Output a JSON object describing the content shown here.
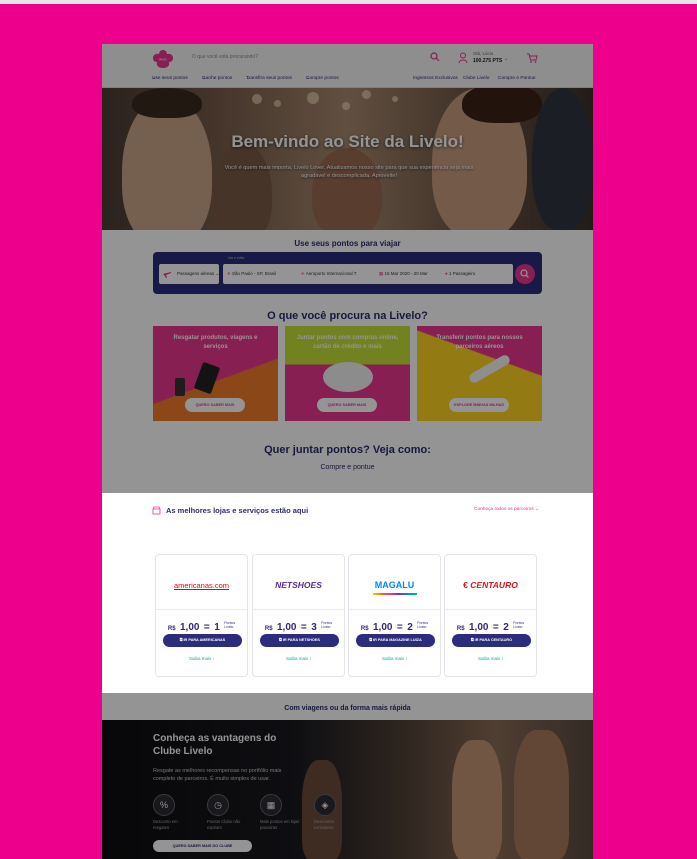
{
  "header": {
    "search_placeholder": "O que você está procurando?",
    "greeting": "Olá, Lúcio",
    "points": "100.275 PTS",
    "nav_left": [
      "Use seus pontos",
      "Ganhe pontos",
      "Transfira seus pontos",
      "Compre pontos"
    ],
    "nav_right": [
      "Ingressos Exclusivos",
      "Clube Livelo",
      "Compre e Pontue"
    ]
  },
  "hero": {
    "title": "Bem-vindo ao Site da Livelo!",
    "subtitle": "Você é quem mais importa, Livelo Lover. Atualizamos nosso site para que sua experiência seja mais agradável e descomplicada. Aproveite!"
  },
  "travel": {
    "title": "Use seus pontos para viajar",
    "trip_type": "Passagens aéreas",
    "origin_label": "Ida e volta",
    "origin": "São Paulo - SP, Brasil",
    "destination": "Aeroporto Internacional T",
    "dates": "15 Mar 2020 - 20 Mar",
    "passengers": "1 Passageiro"
  },
  "looking_for": {
    "title": "O que você procura na Livelo?",
    "cards": [
      {
        "text": "Resgatar produtos, viagens e serviços",
        "button": "QUERO SABER MAIS",
        "color": "#e8368f"
      },
      {
        "text": "Juntar pontos com compras online, cartão de crédito e mais",
        "button": "QUERO SABER MAIS",
        "color": "#e8368f"
      },
      {
        "text": "Transferir pontos para nossos parceiros aéreos",
        "button": "EXPLORE MINHAS MILHAS",
        "color": "#ffd21f"
      }
    ]
  },
  "join": {
    "title": "Quer juntar pontos? Veja como:",
    "tab": "Compre e pontue"
  },
  "stores": {
    "title": "As melhores lojas e serviços estão aqui",
    "link": "Conheça todos os parceiros",
    "items": [
      {
        "name": "americanas.com",
        "amount": "1,00",
        "points": "1",
        "button": "IR PARA AMERICANAS",
        "more": "Saiba mais"
      },
      {
        "name": "NETSHOES",
        "amount": "1,00",
        "points": "3",
        "button": "IR PARA NETSHOES",
        "more": "Saiba mais"
      },
      {
        "name": "MAGALU",
        "amount": "1,00",
        "points": "2",
        "button": "IR PARA MAGAZINE LUIZA",
        "more": "Saiba mais"
      },
      {
        "name": "CENTAURO",
        "amount": "1,00",
        "points": "2",
        "button": "IR PARA CENTAURO",
        "more": "Saiba mais"
      }
    ],
    "currency": "R$",
    "eq": "=",
    "points_label_1": "Pontos",
    "points_label_2": "Livelo"
  },
  "fast": {
    "title": "Com viagens ou da forma mais rápida"
  },
  "club": {
    "title_1": "Conheça as vantagens do",
    "title_2": "Clube Livelo",
    "desc": "Resgate as melhores recompensas no portfólio mais completo de parceiros. É muito simples de usar.",
    "benefits": [
      "Desconto em resgates",
      "Pontos Clube não expiram",
      "Mais pontos em lojas parceiras",
      "Descontos exclusivos"
    ],
    "button": "QUERO SABER MAIS DO CLUBE"
  },
  "colors": {
    "brand_pink": "#ec008c",
    "navy": "#2c2c7c",
    "accent_pink": "#e8368f"
  }
}
